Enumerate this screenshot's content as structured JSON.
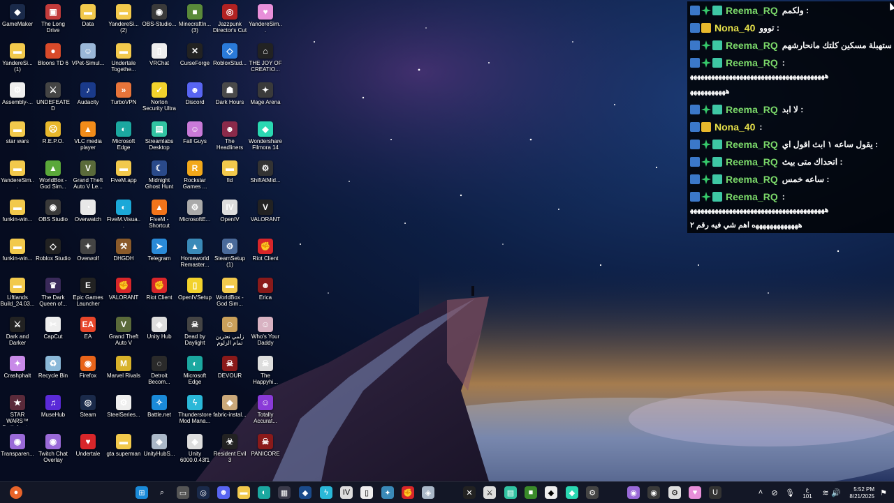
{
  "desktop": {
    "icons": [
      {
        "label": "GameMaker",
        "color": "#1a2a4a",
        "glyph": "◆"
      },
      {
        "label": "The Long Drive",
        "color": "#c23b3b",
        "glyph": "▣"
      },
      {
        "label": "Data",
        "color": "#f2c94c",
        "glyph": "▬"
      },
      {
        "label": "YandereSi... (2)",
        "color": "#f2c94c",
        "glyph": "▬"
      },
      {
        "label": "OBS-Studio...",
        "color": "#3a3a3a",
        "glyph": "◉"
      },
      {
        "label": "MinecraftIn... (3)",
        "color": "#5a8a3a",
        "glyph": "■"
      },
      {
        "label": "Jazzpunk Director's Cut",
        "color": "#b22222",
        "glyph": "◎"
      },
      {
        "label": "YandereSim...",
        "color": "#e88fd9",
        "glyph": "♥"
      },
      {
        "label": "YandereSi... (1)",
        "color": "#f2c94c",
        "glyph": "▬"
      },
      {
        "label": "Bloons TD 6",
        "color": "#d84a2a",
        "glyph": "●"
      },
      {
        "label": "VPet-Simul...",
        "color": "#9ab7d8",
        "glyph": "☺"
      },
      {
        "label": "Undertale Togethe...",
        "color": "#f2c94c",
        "glyph": "▬"
      },
      {
        "label": "VRChat",
        "color": "#eeeeee",
        "glyph": "▯"
      },
      {
        "label": "CurseForge",
        "color": "#222222",
        "glyph": "✕"
      },
      {
        "label": "RobloxStud...",
        "color": "#2a7ad8",
        "glyph": "◇"
      },
      {
        "label": "THE JOY OF CREATIO...",
        "color": "#222222",
        "glyph": "⌂"
      },
      {
        "label": "Assembly-...",
        "color": "#eeeeee",
        "glyph": "⚙"
      },
      {
        "label": "UNDEFEATED",
        "color": "#444444",
        "glyph": "⚔"
      },
      {
        "label": "Audacity",
        "color": "#1a3a8a",
        "glyph": "♪"
      },
      {
        "label": "TurboVPN",
        "color": "#e8743a",
        "glyph": "»"
      },
      {
        "label": "Norton Security Ultra",
        "color": "#f2d22c",
        "glyph": "✓"
      },
      {
        "label": "Discord",
        "color": "#5865f2",
        "glyph": "☻"
      },
      {
        "label": "Dark Hours",
        "color": "#4a4a4a",
        "glyph": "☗"
      },
      {
        "label": "Mage Arena",
        "color": "#3a3a3a",
        "glyph": "✦"
      },
      {
        "label": "star wars",
        "color": "#f2c94c",
        "glyph": "▬"
      },
      {
        "label": "R.E.P.O.",
        "color": "#e8b82c",
        "glyph": "☹"
      },
      {
        "label": "VLC media player",
        "color": "#f28c1a",
        "glyph": "▲"
      },
      {
        "label": "Microsoft Edge",
        "color": "#1ba8a0",
        "glyph": "◐"
      },
      {
        "label": "Streamlabs Desktop",
        "color": "#31c3a2",
        "glyph": "▤"
      },
      {
        "label": "Fall Guys",
        "color": "#c97ad8",
        "glyph": "☺"
      },
      {
        "label": "The Headliners",
        "color": "#8a2a4a",
        "glyph": "☻"
      },
      {
        "label": "Wondershare Filmora 14",
        "color": "#2ad8b2",
        "glyph": "◆"
      },
      {
        "label": "YandereSim...",
        "color": "#f2c94c",
        "glyph": "▬"
      },
      {
        "label": "WorldBox - God Sim...",
        "color": "#5aa83a",
        "glyph": "▲"
      },
      {
        "label": "Grand Theft Auto V Le...",
        "color": "#5a6a3a",
        "glyph": "V"
      },
      {
        "label": "FiveM.app",
        "color": "#f2c94c",
        "glyph": "▬"
      },
      {
        "label": "Midnight Ghost Hunt",
        "color": "#2a4a8a",
        "glyph": "☾"
      },
      {
        "label": "Rockstar Games ...",
        "color": "#f2a81a",
        "glyph": "R"
      },
      {
        "label": "fid",
        "color": "#f2c94c",
        "glyph": "▬"
      },
      {
        "label": "ShiftAtMid...",
        "color": "#333333",
        "glyph": "⚙"
      },
      {
        "label": "funkin-win...",
        "color": "#f2c94c",
        "glyph": "▬"
      },
      {
        "label": "OBS Studio",
        "color": "#3a3a3a",
        "glyph": "◉"
      },
      {
        "label": "Overwatch",
        "color": "#e8e8e8",
        "glyph": "◔"
      },
      {
        "label": "FiveM.Visua...",
        "color": "#1ba8d8",
        "glyph": "◐"
      },
      {
        "label": "FiveM - Shortcut",
        "color": "#f2741a",
        "glyph": "▲"
      },
      {
        "label": "MicrosoftE...",
        "color": "#aaaaaa",
        "glyph": "⚙"
      },
      {
        "label": "OpenIV",
        "color": "#dddddd",
        "glyph": "IV"
      },
      {
        "label": "VALORANT",
        "color": "#222222",
        "glyph": "V"
      },
      {
        "label": "funkin-win...",
        "color": "#f2c94c",
        "glyph": "▬"
      },
      {
        "label": "Roblox Studio",
        "color": "#222222",
        "glyph": "◇"
      },
      {
        "label": "Overwolf",
        "color": "#444444",
        "glyph": "✦"
      },
      {
        "label": "DHGDH",
        "color": "#8a5a2a",
        "glyph": "⚒"
      },
      {
        "label": "Telegram",
        "color": "#2a8ad8",
        "glyph": "➤"
      },
      {
        "label": "Homeworld Remaster...",
        "color": "#3a8ab8",
        "glyph": "▲"
      },
      {
        "label": "SteamSetup (1)",
        "color": "#4a6a9a",
        "glyph": "⚙"
      },
      {
        "label": "Riot Client",
        "color": "#d8262a",
        "glyph": "✊"
      },
      {
        "label": "Liftlands Build_24.03...",
        "color": "#f2c94c",
        "glyph": "▬"
      },
      {
        "label": "The Dark Queen of...",
        "color": "#3a2a5a",
        "glyph": "♛"
      },
      {
        "label": "Epic Games Launcher",
        "color": "#222222",
        "glyph": "E"
      },
      {
        "label": "VALORANT",
        "color": "#d8262a",
        "glyph": "✊"
      },
      {
        "label": "Riot Client",
        "color": "#d8262a",
        "glyph": "✊"
      },
      {
        "label": "OpenIVSetup",
        "color": "#f2d22c",
        "glyph": "▯"
      },
      {
        "label": "WorldBox - God Sim...",
        "color": "#f2c94c",
        "glyph": "▬"
      },
      {
        "label": "Erica",
        "color": "#8a1a1a",
        "glyph": "☻"
      },
      {
        "label": "Dark and Darker",
        "color": "#222222",
        "glyph": "⚔"
      },
      {
        "label": "CapCut",
        "color": "#eeeeee",
        "glyph": "✂"
      },
      {
        "label": "EA",
        "color": "#e8462a",
        "glyph": "EA"
      },
      {
        "label": "Grand Theft Auto V",
        "color": "#5a6a3a",
        "glyph": "V"
      },
      {
        "label": "Unity Hub",
        "color": "#dddddd",
        "glyph": "◈"
      },
      {
        "label": "Dead by Daylight",
        "color": "#444444",
        "glyph": "☠"
      },
      {
        "label": "زلمي نعثرين تمام الزلوم",
        "color": "#caa05a",
        "glyph": "☺"
      },
      {
        "label": "Who's Your Daddy",
        "color": "#d8b2c2",
        "glyph": "☺"
      },
      {
        "label": "Crashphalt",
        "color": "#c88ae8",
        "glyph": "✦"
      },
      {
        "label": "Recycle Bin",
        "color": "#8ab8d8",
        "glyph": "♻"
      },
      {
        "label": "Firefox",
        "color": "#e8641a",
        "glyph": "◉"
      },
      {
        "label": "Marvel Rivals",
        "color": "#d8b22a",
        "glyph": "M"
      },
      {
        "label": "Detroit Becom...",
        "color": "#2a2a2a",
        "glyph": "◌"
      },
      {
        "label": "Microsoft Edge",
        "color": "#1ba8a0",
        "glyph": "◐"
      },
      {
        "label": "DEVOUR",
        "color": "#8a1a1a",
        "glyph": "☠"
      },
      {
        "label": "The Happyhi...",
        "color": "#dddddd",
        "glyph": "☠"
      },
      {
        "label": "STAR WARS™ Battlefront...",
        "color": "#5a2a3a",
        "glyph": "★"
      },
      {
        "label": "MuseHub",
        "color": "#5a2ad8",
        "glyph": "♫"
      },
      {
        "label": "Steam",
        "color": "#1a2a4a",
        "glyph": "◎"
      },
      {
        "label": "SteelSeries...",
        "color": "#eeeeee",
        "glyph": "⚙"
      },
      {
        "label": "Battle.net",
        "color": "#1a8ad8",
        "glyph": "✧"
      },
      {
        "label": "Thunderstore Mod Mana...",
        "color": "#2ab8d8",
        "glyph": "ϟ"
      },
      {
        "label": "fabric-instal...",
        "color": "#caa87a",
        "glyph": "◆"
      },
      {
        "label": "Totally Accurat...",
        "color": "#8a3ad8",
        "glyph": "☺"
      },
      {
        "label": "Transparen...",
        "color": "#9a6ad8",
        "glyph": "◉"
      },
      {
        "label": "Twitch Chat Overlay",
        "color": "#9a6ad8",
        "glyph": "◉"
      },
      {
        "label": "Undertale",
        "color": "#d8262a",
        "glyph": "♥"
      },
      {
        "label": "gta superman",
        "color": "#f2c94c",
        "glyph": "▬"
      },
      {
        "label": "UnityHubS...",
        "color": "#aab8c8",
        "glyph": "◈"
      },
      {
        "label": "Unity 6000.0.43f1",
        "color": "#dddddd",
        "glyph": "◈"
      },
      {
        "label": "Resident Evil 3",
        "color": "#222222",
        "glyph": "☣"
      },
      {
        "label": "PANICORE",
        "color": "#8a1a1a",
        "glyph": "☠"
      }
    ]
  },
  "chat": {
    "lines": [
      {
        "user": "Reema_RQ",
        "style": "reema",
        "message": "ولكمم :"
      },
      {
        "user": "Nona_40",
        "style": "nona",
        "message": "تووو :"
      },
      {
        "user": "Reema_RQ",
        "style": "reema",
        "message": "مستهبلة مسكين كلتك مانحارشهم :"
      },
      {
        "user": "Reema_RQ",
        "style": "reema",
        "message": ":"
      },
      {
        "user": "Reema_RQ",
        "style": "reema",
        "message": "لا ابد :"
      },
      {
        "user": "Nona_40",
        "style": "nona",
        "message": ":"
      },
      {
        "user": "Reema_RQ",
        "style": "reema",
        "message": "يقول ساعه ١ ابث اقول اي :"
      },
      {
        "user": "Reema_RQ",
        "style": "reema",
        "message": "اتحداك متى بيث :"
      },
      {
        "user": "Reema_RQ",
        "style": "reema",
        "message": "ساعه خمس :"
      },
      {
        "user": "Reema_RQ",
        "style": "reema",
        "message": ":"
      }
    ],
    "cont1a": "ﻫﻬﻬﻬﻬﻬﻬﻬﻬﻬﻬﻬﻬﻬﻬﻬﻬﻬﻬﻬﻬﻬﻬﻬﻬﻬﻬﻬﻬﻬﻬﻬﻬﻬﻬﻬﻬﻬﻬ",
    "cont1b": "ﻫﻬﻬﻬﻬﻬﻬﻬﻬﻬﻬ",
    "cont2a": "ﻫﻬﻬﻬﻬﻬﻬﻬﻬﻬﻬﻬﻬﻬﻬﻬﻬﻬﻬﻬﻬﻬﻬﻬﻬﻬﻬﻬﻬﻬﻬﻬﻬﻬﻬﻬﻬﻬﻬ",
    "cont2b": "ﻫﻬﻬﻬﻬﻬﻬﻬﻬﻬﻬﻬﻬه اهم شي فيه رقم ٢"
  },
  "taskbar": {
    "time": "5:52 PM",
    "date": "8/21/2025",
    "lang": "ع",
    "lang2": "101"
  }
}
